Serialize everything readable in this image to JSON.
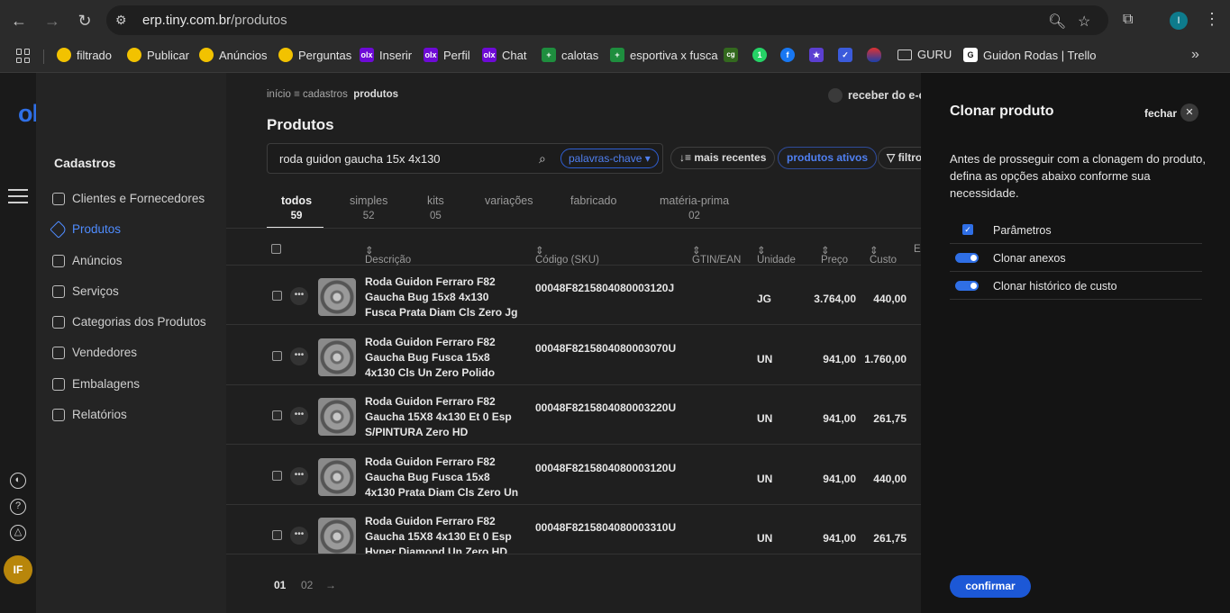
{
  "browser": {
    "url_host": "erp.tiny.com.br",
    "url_path": "/produtos",
    "profile_initial": "I",
    "bookmarks": [
      {
        "label": "filtrado",
        "icon": "y",
        "icon_text": ""
      },
      {
        "label": "Publicar",
        "icon": "y",
        "icon_text": ""
      },
      {
        "label": "Anúncios",
        "icon": "y",
        "icon_text": ""
      },
      {
        "label": "Perguntas",
        "icon": "y",
        "icon_text": ""
      },
      {
        "label": "Inserir",
        "icon": "olx",
        "icon_text": "olx"
      },
      {
        "label": "Perfil",
        "icon": "olx",
        "icon_text": "olx"
      },
      {
        "label": "Chat",
        "icon": "olx",
        "icon_text": "olx"
      },
      {
        "label": "calotas",
        "icon": "g",
        "icon_text": "+"
      },
      {
        "label": "esportiva x fusca",
        "icon": "g",
        "icon_text": "+"
      },
      {
        "label": "",
        "icon": "cg",
        "icon_text": "cg"
      },
      {
        "label": "",
        "icon": "wa",
        "icon_text": "1"
      },
      {
        "label": "",
        "icon": "fb",
        "icon_text": "f"
      },
      {
        "label": "",
        "icon": "st",
        "icon_text": "★"
      },
      {
        "label": "",
        "icon": "bt",
        "icon_text": "✓"
      },
      {
        "label": "",
        "icon": "rd",
        "icon_text": ""
      },
      {
        "label": "GURU",
        "icon": "folder",
        "icon_text": ""
      },
      {
        "label": "Guidon Rodas | Trello",
        "icon": "tr",
        "icon_text": "G"
      }
    ]
  },
  "sidebar": {
    "logo": "olist",
    "section_title": "Cadastros",
    "items": [
      {
        "label": "Clientes e Fornecedores",
        "active": false
      },
      {
        "label": "Produtos",
        "active": true
      },
      {
        "label": "Anúncios",
        "active": false
      },
      {
        "label": "Serviços",
        "active": false
      },
      {
        "label": "Categorias dos Produtos",
        "active": false
      },
      {
        "label": "Vendedores",
        "active": false
      },
      {
        "label": "Embalagens",
        "active": false
      },
      {
        "label": "Relatórios",
        "active": false
      }
    ],
    "avatar_initials": "IF"
  },
  "main": {
    "breadcrumb": {
      "inicio": "início",
      "cadastros": "cadastros",
      "current": "produtos"
    },
    "receber": "receber do e-c",
    "title": "Produtos",
    "search_value": "roda guidon gaucha 15x 4x130",
    "keyword_chip": "palavras-chave",
    "sort_button": "mais recentes",
    "status_button": "produtos ativos",
    "filter_button": "filtro",
    "tabs": [
      {
        "label": "todos",
        "count": "59",
        "active": true
      },
      {
        "label": "simples",
        "count": "52",
        "active": false
      },
      {
        "label": "kits",
        "count": "05",
        "active": false
      },
      {
        "label": "variações",
        "count": "",
        "active": false
      },
      {
        "label": "fabricado",
        "count": "",
        "active": false
      },
      {
        "label": "matéria-prima",
        "count": "02",
        "active": false
      }
    ],
    "columns": {
      "descricao": "Descrição",
      "sku": "Código (SKU)",
      "gtin": "GTIN/EAN",
      "unidade": "Unidade",
      "preco": "Preço",
      "custo": "Custo",
      "extra": "E"
    },
    "rows": [
      {
        "desc": "Roda Guidon Ferraro F82 Gaucha Bug 15x8 4x130 Fusca Prata Diam Cls Zero Jg",
        "sku": "00048F8215804080003120J",
        "unidade": "JG",
        "preco": "3.764,00",
        "custo": "440,00"
      },
      {
        "desc": "Roda Guidon Ferraro F82 Gaucha Bug Fusca 15x8 4x130 Cls Un Zero Polido",
        "sku": "00048F8215804080003070U",
        "unidade": "UN",
        "preco": "941,00",
        "custo": "1.760,00"
      },
      {
        "desc": "Roda Guidon Ferraro F82 Gaucha 15X8 4x130 Et 0 Esp S/PINTURA Zero HD",
        "sku": "00048F8215804080003220U",
        "unidade": "UN",
        "preco": "941,00",
        "custo": "261,75"
      },
      {
        "desc": "Roda Guidon Ferraro F82 Gaucha Bug Fusca 15x8 4x130 Prata Diam Cls Zero Un",
        "sku": "00048F8215804080003120U",
        "unidade": "UN",
        "preco": "941,00",
        "custo": "440,00"
      },
      {
        "desc": "Roda Guidon Ferraro F82 Gaucha 15X8 4x130 Et 0 Esp Hyper Diamond Un Zero HD",
        "sku": "00048F8215804080003310U",
        "unidade": "UN",
        "preco": "941,00",
        "custo": "261,75"
      }
    ],
    "pagination": {
      "page1": "01",
      "page2": "02",
      "next": "→"
    }
  },
  "clone_panel": {
    "title": "Clonar produto",
    "close_label": "fechar",
    "description": "Antes de prosseguir com a clonagem do produto, defina as opções abaixo conforme sua necessidade.",
    "options": [
      {
        "label": "Parâmetros",
        "type": "checkbox",
        "checked": true
      },
      {
        "label": "Clonar anexos",
        "type": "toggle",
        "checked": true
      },
      {
        "label": "Clonar histórico de custo",
        "type": "toggle",
        "checked": true
      }
    ],
    "confirm_label": "confirmar"
  }
}
